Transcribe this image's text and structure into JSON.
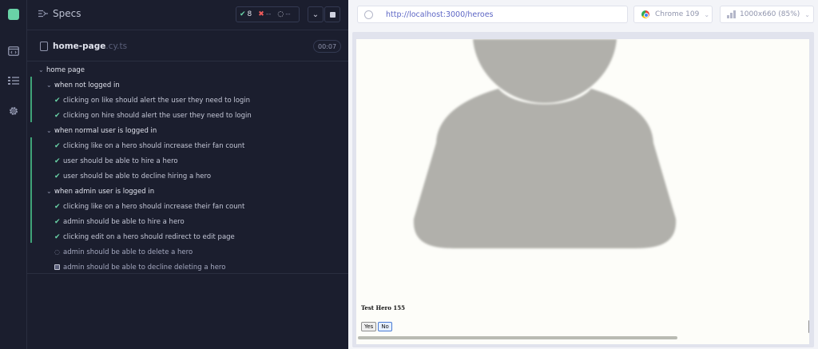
{
  "colors": {
    "pass": "#69d3a7",
    "fail": "#f15b5b",
    "bg": "#1b1e2e",
    "url": "#5d66c5"
  },
  "rail": {
    "icons": [
      "cypress-logo-icon",
      "runs-icon",
      "specs-list-icon",
      "settings-gear-icon"
    ]
  },
  "reporter": {
    "title": "Specs",
    "stats": {
      "passed": "8",
      "failed": "--",
      "pending": "--"
    },
    "spec": {
      "name": "home-page",
      "ext": ".cy.ts",
      "duration": "00:07"
    }
  },
  "tree": {
    "root": "home page",
    "suites": [
      {
        "title": "when not logged in",
        "tests": [
          {
            "title": "clicking on like should alert the user they need to login",
            "state": "passed"
          },
          {
            "title": "clicking on hire should alert the user they need to login",
            "state": "passed"
          }
        ]
      },
      {
        "title": "when normal user is logged in",
        "tests": [
          {
            "title": "clicking like on a hero should increase their fan count",
            "state": "passed"
          },
          {
            "title": "user should be able to hire a hero",
            "state": "passed"
          },
          {
            "title": "user should be able to decline hiring a hero",
            "state": "passed"
          }
        ]
      },
      {
        "title": "when admin user is logged in",
        "tests": [
          {
            "title": "clicking like on a hero should increase their fan count",
            "state": "passed"
          },
          {
            "title": "admin should be able to hire a hero",
            "state": "passed"
          },
          {
            "title": "clicking edit on a hero should redirect to edit page",
            "state": "passed"
          },
          {
            "title": "admin should be able to delete a hero",
            "state": "running"
          },
          {
            "title": "admin should be able to decline deleting a hero",
            "state": "pending"
          }
        ]
      }
    ]
  },
  "aut": {
    "url": "http://localhost:3000/heroes",
    "browser": "Chrome 109",
    "viewport": "1000x660 (85%)",
    "hero_name": "Test Hero 155",
    "yes_label": "Yes",
    "no_label": "No"
  }
}
